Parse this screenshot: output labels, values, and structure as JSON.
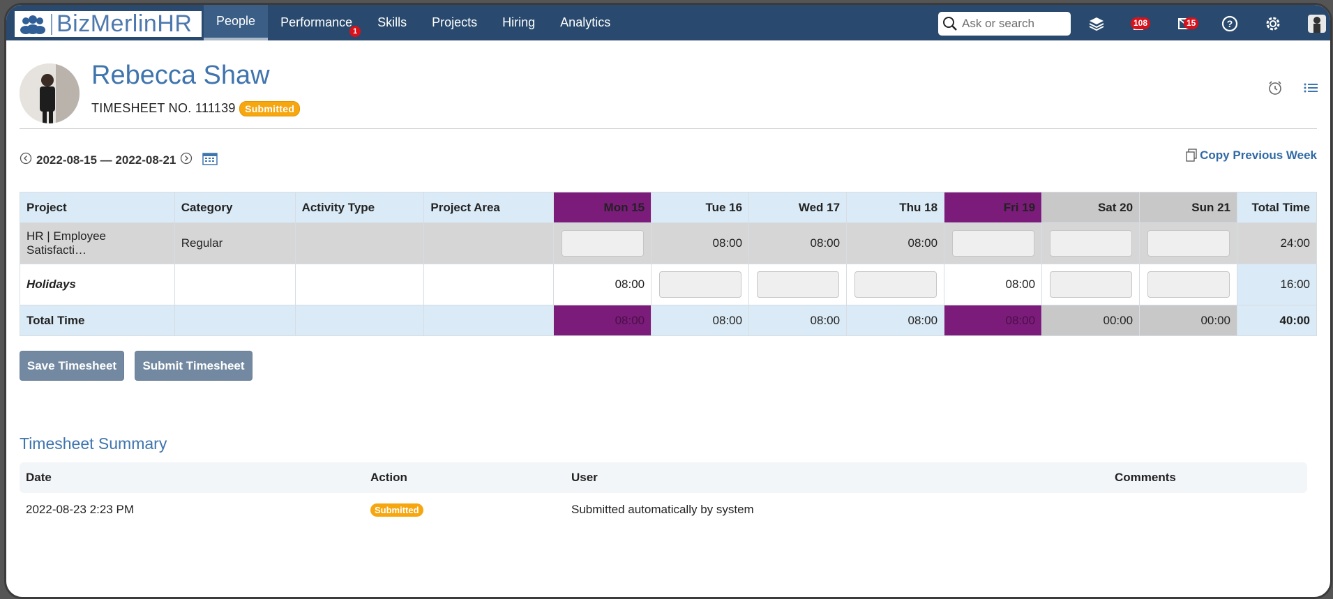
{
  "app": {
    "logo_text": "BizMerlinHR",
    "nav": [
      {
        "label": "People"
      },
      {
        "label": "Performance",
        "badge": "1"
      },
      {
        "label": "Skills"
      },
      {
        "label": "Projects"
      },
      {
        "label": "Hiring"
      },
      {
        "label": "Analytics"
      }
    ],
    "search_placeholder": "Ask or search",
    "notifications_count": "108",
    "messages_count": "15"
  },
  "employee": {
    "name": "Rebecca Shaw",
    "timesheet_label": "TIMESHEET NO. 111139",
    "status": "Submitted"
  },
  "week": {
    "range": "2022-08-15 — 2022-08-21",
    "copy_previous": "Copy Previous Week"
  },
  "table": {
    "headers": [
      "Project",
      "Category",
      "Activity Type",
      "Project Area",
      "Mon 15",
      "Tue 16",
      "Wed 17",
      "Thu 18",
      "Fri 19",
      "Sat 20",
      "Sun 21",
      "Total Time"
    ],
    "row1": {
      "project": "HR | Employee Satisfacti…",
      "category": "Regular",
      "activity": "",
      "area": "",
      "mon": "",
      "tue": "08:00",
      "wed": "08:00",
      "thu": "08:00",
      "fri": "",
      "sat": "",
      "sun": "",
      "total": "24:00"
    },
    "row2": {
      "project": "Holidays",
      "mon": "08:00",
      "fri": "08:00",
      "total": "16:00"
    },
    "totals": {
      "label": "Total Time",
      "mon": "08:00",
      "tue": "08:00",
      "wed": "08:00",
      "thu": "08:00",
      "fri": "08:00",
      "sat": "00:00",
      "sun": "00:00",
      "total": "40:00"
    }
  },
  "buttons": {
    "save": "Save Timesheet",
    "submit": "Submit Timesheet"
  },
  "summary": {
    "title": "Timesheet Summary",
    "headers": [
      "Date",
      "Action",
      "User",
      "Comments"
    ],
    "rows": [
      {
        "date": "2022-08-23 2:23 PM",
        "action": "Submitted",
        "user": "Submitted automatically by system",
        "comments": ""
      }
    ]
  },
  "colors": {
    "topbar": "#294a6e",
    "accent": "#3f74ad",
    "highlight_day": "#7b1b7a",
    "weekend": "#c8c8c8",
    "badge": "#f6a60f"
  }
}
